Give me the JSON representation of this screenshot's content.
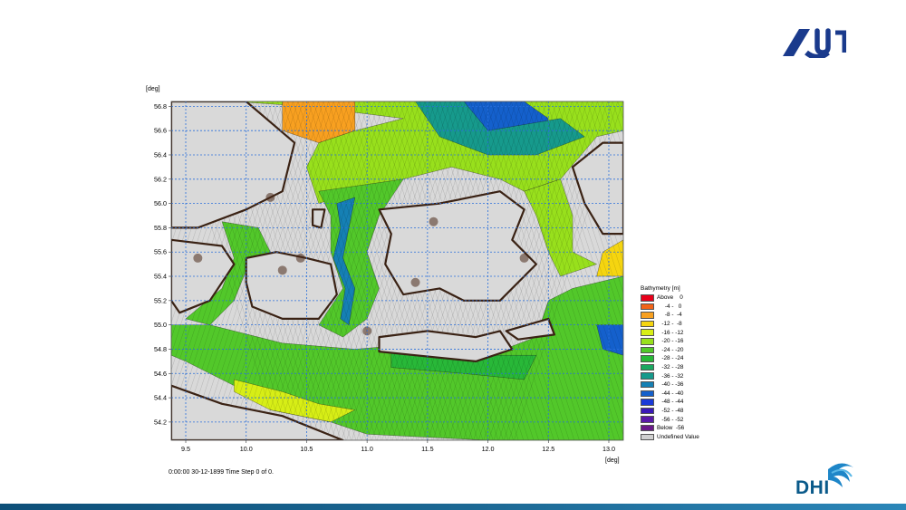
{
  "chart_data": {
    "type": "heatmap",
    "title": "",
    "xlabel": "[deg]",
    "ylabel": "[deg]",
    "xlim": [
      9.38,
      13.12
    ],
    "ylim": [
      54.05,
      56.84
    ],
    "x_ticks": [
      "9.5",
      "10.0",
      "10.5",
      "11.0",
      "11.5",
      "12.0",
      "12.5",
      "13.0"
    ],
    "x_tick_values": [
      9.5,
      10.0,
      10.5,
      11.0,
      11.5,
      12.0,
      12.5,
      13.0
    ],
    "y_ticks": [
      "56.8",
      "56.6",
      "56.4",
      "56.2",
      "56.0",
      "55.8",
      "55.6",
      "55.4",
      "55.2",
      "55.0",
      "54.8",
      "54.6",
      "54.4",
      "54.2"
    ],
    "y_tick_values": [
      56.8,
      56.6,
      56.4,
      56.2,
      56.0,
      55.8,
      55.6,
      55.4,
      55.2,
      55.0,
      54.8,
      54.6,
      54.4,
      54.2
    ],
    "grid": true,
    "legend_placement": "right",
    "legend": {
      "title": "Bathymetry [m]",
      "entries": [
        {
          "label": "Above    0",
          "color": "#e8001a"
        },
        {
          "label": "     -4 -   0",
          "color": "#f26418"
        },
        {
          "label": "     -8 -  -4",
          "color": "#f8a020"
        },
        {
          "label": "   -12 -  -8",
          "color": "#f5d510"
        },
        {
          "label": "   -16 - -12",
          "color": "#d7ee16"
        },
        {
          "label": "   -20 - -16",
          "color": "#98e01c"
        },
        {
          "label": "   -24 - -20",
          "color": "#52c82a"
        },
        {
          "label": "   -28 - -24",
          "color": "#28b838"
        },
        {
          "label": "   -32 - -28",
          "color": "#1aa860"
        },
        {
          "label": "   -36 - -32",
          "color": "#169a8c"
        },
        {
          "label": "   -40 - -36",
          "color": "#1580b4"
        },
        {
          "label": "   -44 - -40",
          "color": "#1460cc"
        },
        {
          "label": "   -48 - -44",
          "color": "#1a3ad8"
        },
        {
          "label": "   -52 - -48",
          "color": "#3a1ab8"
        },
        {
          "label": "   -56 - -52",
          "color": "#5a1aa8"
        },
        {
          "label": "Below  -56",
          "color": "#6a1a8a"
        },
        {
          "label": "Undefined Value",
          "color": "#d0d0d0"
        }
      ]
    },
    "status": "0:00:00 30-12-1899  Time Step 0 of 0.",
    "colors": {
      "land": "#d9d9d9",
      "grid": "#2a6fdb",
      "mesh": "#000000"
    }
  }
}
